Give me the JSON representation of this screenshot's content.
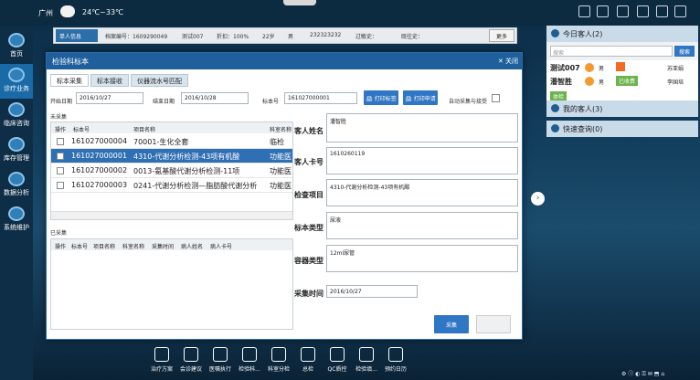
{
  "topbar": {
    "city": "广州",
    "temperature": "24℃~33℃"
  },
  "nav": [
    {
      "label": "首页"
    },
    {
      "label": "诊疗业务"
    },
    {
      "label": "临床咨询"
    },
    {
      "label": "库存管理"
    },
    {
      "label": "数据分析"
    },
    {
      "label": "系统维护"
    }
  ],
  "infobar": {
    "tab": "单人信息",
    "archive": "档案编号：1609290049",
    "name": "测试007",
    "discount": "折扣：100%",
    "age": "22岁",
    "gender": "男",
    "phone": "232323232",
    "allergy": "过敏史：",
    "history": "既往史：",
    "more": "更多"
  },
  "dialog": {
    "title": "检验科标本",
    "close": "关闭",
    "tabs": [
      "标本采集",
      "标本接收",
      "仪器流水号匹配"
    ],
    "start_label": "开始日期",
    "start_date": "2016/10/27",
    "end_label": "结束日期",
    "end_date": "2016/10/28",
    "specimen_no_label": "标本号",
    "specimen_no": "161027000001",
    "print_barcode": "打印标签",
    "print_request": "打印申请",
    "auto_collect": "自动采集与接受",
    "uncollected_label": "未采集",
    "uncollected_headers": [
      "操作",
      "标本号",
      "项目名称",
      "科室名称"
    ],
    "uncollected_rows": [
      {
        "no": "161027000004",
        "item": "70001-生化全套",
        "dept": "临检"
      },
      {
        "no": "161027000001",
        "item": "4310-代谢分析检测-43项有机酸",
        "dept": "功能医"
      },
      {
        "no": "161027000002",
        "item": "0013-氨基酸代谢分析检测-11项",
        "dept": "功能医"
      },
      {
        "no": "161027000003",
        "item": "0241-代谢分析检测—脂肪酸代谢分析",
        "dept": "功能医"
      }
    ],
    "collected_label": "已采集",
    "collected_headers": [
      "操作",
      "标本号",
      "项目名称",
      "科室名称",
      "采集时间",
      "病人姓名",
      "病人卡号"
    ],
    "form": {
      "name_label": "客人姓名",
      "name": "潘智胜",
      "card_label": "客人卡号",
      "card": "1610260119",
      "items_label": "检查项目",
      "items": "4310-代谢分析检测-43项有机酸",
      "type_label": "标本类型",
      "type": "尿液",
      "container_label": "容器类型",
      "container": "12ml尿管",
      "time_label": "采集时间",
      "time": "2016/10/27"
    },
    "collect_button": "采集"
  },
  "right": {
    "today": "今日客人(2)",
    "search_placeholder": "搜索",
    "search_btn": "搜索",
    "guests": [
      {
        "name": "测试007",
        "gender": "男",
        "doctor": "苏亚娟"
      },
      {
        "name": "潘智胜",
        "gender": "男",
        "status": "已收费",
        "doctor": "李国培",
        "tag": "体检"
      }
    ],
    "mine": "我的客人(3)",
    "quick": "快速查询(0)"
  },
  "dock": [
    "治疗方案",
    "会诊建议",
    "医嘱执行",
    "检验科...",
    "科室分检",
    "总检",
    "QC质控",
    "检验填...",
    "预约日历"
  ],
  "colors": {
    "accent": "#2f6fb3",
    "title": "#1e5f9c"
  }
}
